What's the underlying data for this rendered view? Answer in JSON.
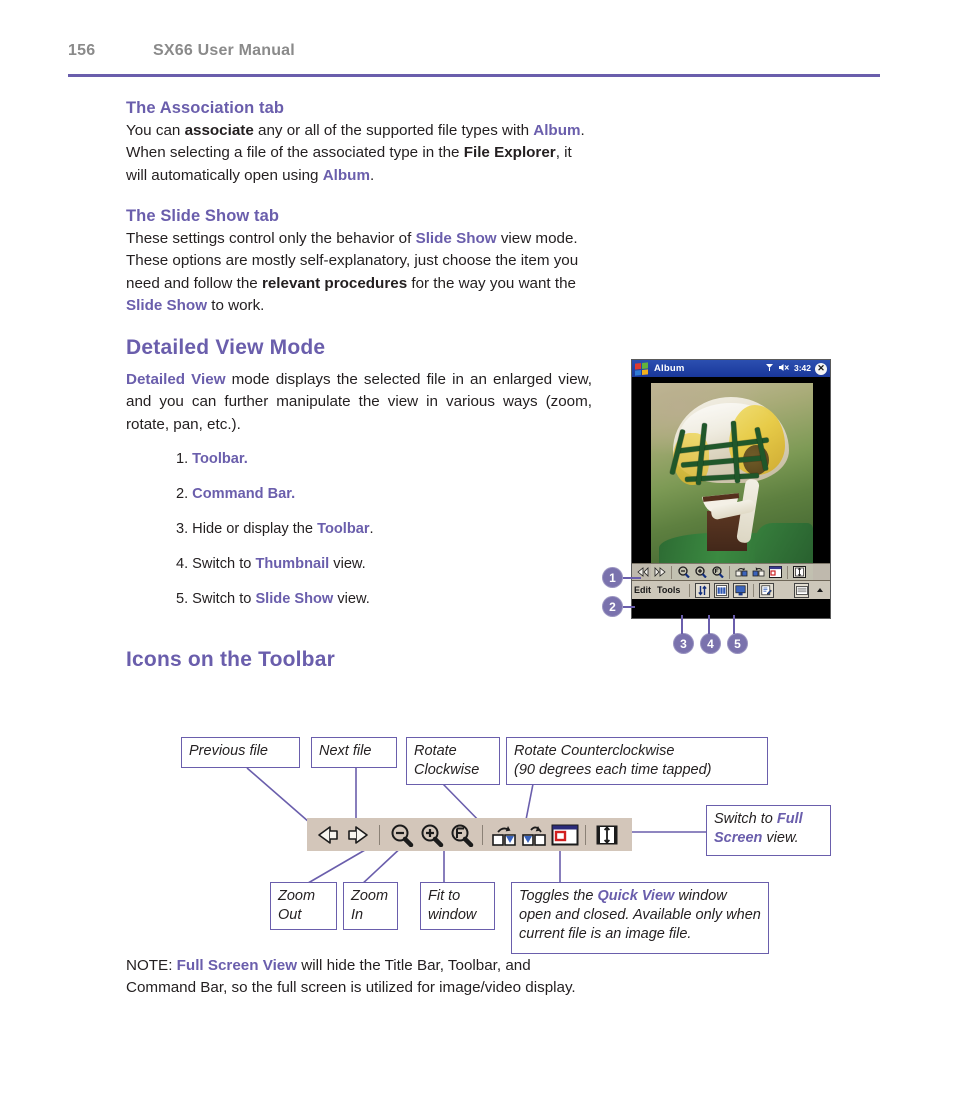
{
  "header": {
    "page_number": "156",
    "manual_title": "SX66 User Manual"
  },
  "sections": {
    "association": {
      "heading": "The Association tab",
      "body_parts": [
        {
          "t": "You can ",
          "s": "n"
        },
        {
          "t": "associate",
          "s": "b"
        },
        {
          "t": " any or all of the supported file types with ",
          "s": "n"
        },
        {
          "t": "Album",
          "s": "p"
        },
        {
          "t": ". When selecting a file of the associated type in the ",
          "s": "n"
        },
        {
          "t": "File Explorer",
          "s": "b"
        },
        {
          "t": ", it will automatically open using ",
          "s": "n"
        },
        {
          "t": "Album",
          "s": "p"
        },
        {
          "t": ".",
          "s": "n"
        }
      ]
    },
    "slideshow": {
      "heading": "The Slide Show tab",
      "body_parts": [
        {
          "t": "These settings control only the behavior of ",
          "s": "n"
        },
        {
          "t": "Slide Show",
          "s": "p"
        },
        {
          "t": " view mode. These options are mostly self-explanatory, just choose the item you need and follow the ",
          "s": "n"
        },
        {
          "t": "relevant procedures",
          "s": "b"
        },
        {
          "t": " for the way you want the ",
          "s": "n"
        },
        {
          "t": "Slide Show",
          "s": "p"
        },
        {
          "t": " to work.",
          "s": "n"
        }
      ]
    },
    "detailed_view": {
      "heading": "Detailed View Mode",
      "body_parts": [
        {
          "t": "Detailed View",
          "s": "p"
        },
        {
          "t": " mode displays the selected file in an enlarged view, and you can further manipulate the view in various ways (zoom, rotate, pan, etc.).",
          "s": "n"
        }
      ]
    },
    "icons_toolbar": {
      "heading": "Icons on the Toolbar"
    }
  },
  "numbered_list": [
    {
      "num": "1.",
      "parts": [
        {
          "t": "Toolbar.",
          "s": "p"
        }
      ]
    },
    {
      "num": "2.",
      "parts": [
        {
          "t": "Command Bar.",
          "s": "p"
        }
      ]
    },
    {
      "num": "3.",
      "parts": [
        {
          "t": "Hide or display the ",
          "s": "n"
        },
        {
          "t": "Toolbar",
          "s": "p"
        },
        {
          "t": ".",
          "s": "n"
        }
      ]
    },
    {
      "num": "4.",
      "parts": [
        {
          "t": "Switch to ",
          "s": "n"
        },
        {
          "t": "Thumbnail",
          "s": "p"
        },
        {
          "t": " view.",
          "s": "n"
        }
      ]
    },
    {
      "num": "5.",
      "parts": [
        {
          "t": "Switch to ",
          "s": "n"
        },
        {
          "t": "Slide Show",
          "s": "p"
        },
        {
          "t": " view.",
          "s": "n"
        }
      ]
    }
  ],
  "pda": {
    "title": "Album",
    "status_signal": "signal-icon",
    "status_volume": "speaker-mute-icon",
    "clock": "3:42",
    "close_glyph": "✕",
    "photo_alt": "Smiling football player wearing a green, yellow and white helmet",
    "toolbar_icons": [
      "previous-file-icon",
      "next-file-icon",
      "separator",
      "zoom-out-icon",
      "zoom-in-icon",
      "fit-to-window-icon",
      "separator",
      "rotate-clockwise-icon",
      "rotate-counterclockwise-icon",
      "quick-view-toggle-icon",
      "separator",
      "full-screen-icon"
    ],
    "command_bar": {
      "menu_edit": "Edit",
      "menu_tools": "Tools",
      "icons": [
        "toggle-toolbar-icon",
        "thumbnail-view-icon",
        "slide-show-icon",
        "separator",
        "edit-note-icon",
        "keyboard-icon",
        "input-chevron-icon"
      ]
    },
    "callouts": [
      "1",
      "2",
      "3",
      "4",
      "5"
    ]
  },
  "toolbar_diagram": {
    "icons": [
      "previous-file-icon",
      "next-file-icon",
      "separator",
      "zoom-out-icon",
      "zoom-in-icon",
      "fit-to-window-icon",
      "separator",
      "rotate-clockwise-icon",
      "rotate-counterclockwise-icon",
      "quick-view-toggle-icon",
      "separator",
      "full-screen-icon"
    ],
    "labels": {
      "previous_file": "Previous file",
      "next_file": "Next file",
      "rotate_clockwise": "Rotate\nClockwise",
      "rotate_counterclockwise_l1": "Rotate Counterclockwise",
      "rotate_counterclockwise_l2": "(90 degrees each time tapped)",
      "zoom_out": "Zoom\nOut",
      "zoom_in": "Zoom\nIn",
      "fit_to_window": "Fit to\nwindow",
      "quick_view_parts": [
        {
          "t": "Toggles the ",
          "s": "n"
        },
        {
          "t": "Quick View",
          "s": "p"
        },
        {
          "t": " window open and closed. Available only when current file is an image file.",
          "s": "n"
        }
      ],
      "full_screen_parts": [
        {
          "t": "Switch to ",
          "s": "n"
        },
        {
          "t": "Full Screen",
          "s": "p"
        },
        {
          "t": " view.",
          "s": "n"
        }
      ]
    }
  },
  "note": {
    "parts": [
      {
        "t": "NOTE: ",
        "s": "n"
      },
      {
        "t": "Full Screen View",
        "s": "p"
      },
      {
        "t": " will hide the Title Bar, Toolbar, and Command Bar, so the full screen is utilized for image/video display.",
        "s": "n"
      }
    ]
  },
  "colors": {
    "accent_purple": "#6a5eac",
    "header_gray": "#8a8a8a",
    "toolbar_beige": "#d3c6ba",
    "titlebar_blue": "#1d3a9e"
  }
}
